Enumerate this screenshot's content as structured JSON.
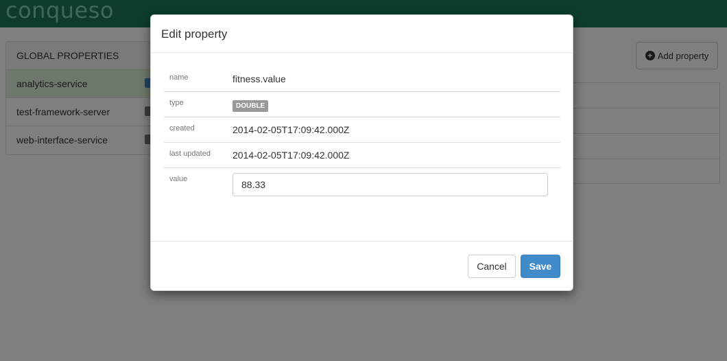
{
  "app": {
    "brand": "conqueso"
  },
  "sidebar": {
    "heading": "GLOBAL PROPERTIES",
    "items": [
      {
        "label": "analytics-service"
      },
      {
        "label": "test-framework-server"
      },
      {
        "label": "web-interface-service"
      }
    ]
  },
  "toolbar": {
    "add_property_label": "Add property"
  },
  "modal": {
    "title": "Edit property",
    "fields": {
      "name": {
        "label": "name",
        "value": "fitness.value"
      },
      "type": {
        "label": "type",
        "value": "DOUBLE"
      },
      "created": {
        "label": "created",
        "value": "2014-02-05T17:09:42.000Z"
      },
      "updated": {
        "label": "last updated",
        "value": "2014-02-05T17:09:42.000Z"
      },
      "value": {
        "label": "value",
        "value": "88.33"
      }
    },
    "cancel_label": "Cancel",
    "save_label": "Save"
  }
}
